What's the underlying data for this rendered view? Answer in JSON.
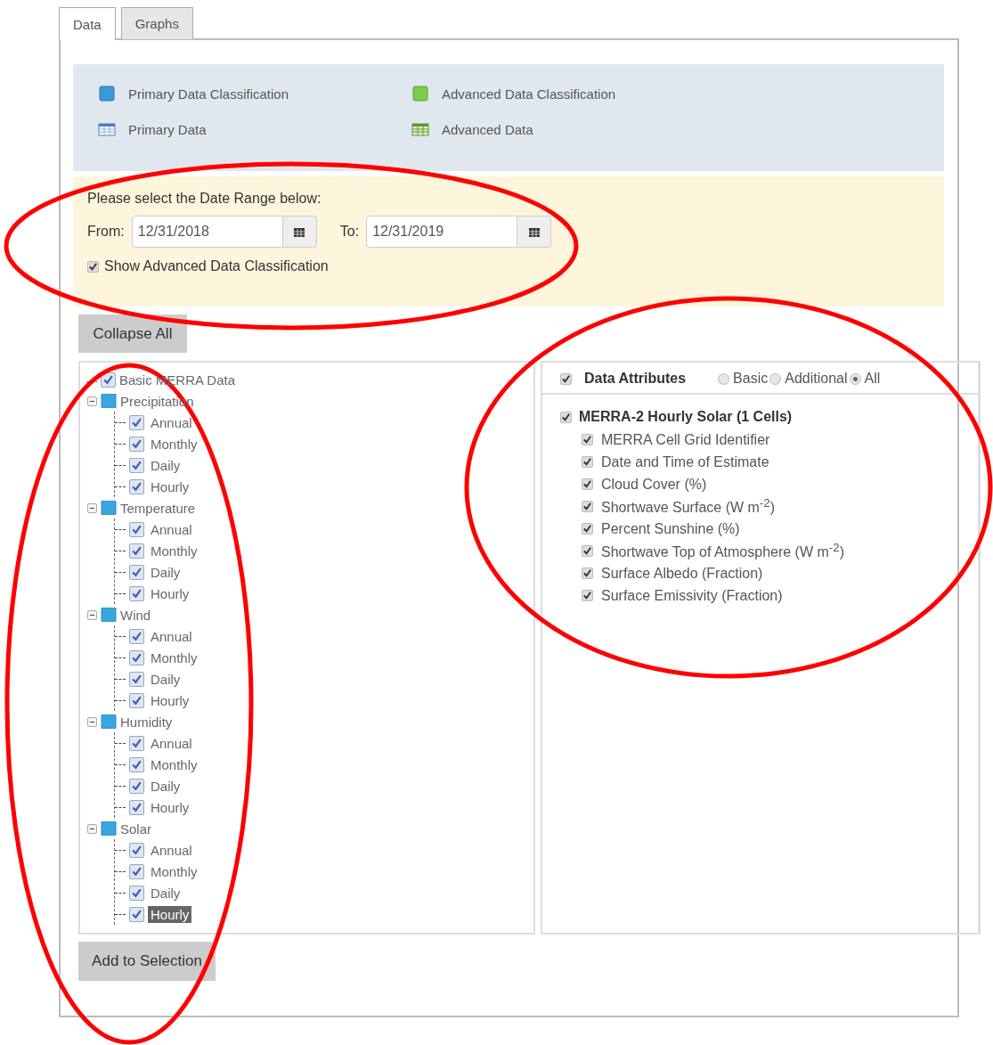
{
  "tabs": [
    {
      "label": "Data",
      "selected": true
    },
    {
      "label": "Graphs",
      "selected": false
    }
  ],
  "legend": [
    {
      "label": "Primary Data Classification",
      "kind": "primary-class"
    },
    {
      "label": "Advanced Data Classification",
      "kind": "advanced-class"
    },
    {
      "label": "Primary Data",
      "kind": "primary-data"
    },
    {
      "label": "Advanced Data",
      "kind": "advanced-data"
    }
  ],
  "date_range": {
    "circled": true,
    "prompt": "Please select the Date Range below:",
    "from_label": "From:",
    "from_value": "12/31/2018",
    "to_label": "To:",
    "to_value": "12/31/2019",
    "advanced_option": {
      "label": "Show Advanced Data Classification",
      "checked": true
    }
  },
  "collapse_button": "Collapse All",
  "tree": {
    "circled": true,
    "root": {
      "label": "Basic MERRA Data",
      "checked": true,
      "children": [
        {
          "label": "Precipitation",
          "expanded": true,
          "children": [
            {
              "label": "Annual",
              "checked": true,
              "selected": false
            },
            {
              "label": "Monthly",
              "checked": true,
              "selected": false
            },
            {
              "label": "Daily",
              "checked": true,
              "selected": false
            },
            {
              "label": "Hourly",
              "checked": true,
              "selected": false
            }
          ]
        },
        {
          "label": "Temperature",
          "expanded": true,
          "children": [
            {
              "label": "Annual",
              "checked": true,
              "selected": false
            },
            {
              "label": "Monthly",
              "checked": true,
              "selected": false
            },
            {
              "label": "Daily",
              "checked": true,
              "selected": false
            },
            {
              "label": "Hourly",
              "checked": true,
              "selected": false
            }
          ]
        },
        {
          "label": "Wind",
          "expanded": true,
          "children": [
            {
              "label": "Annual",
              "checked": true,
              "selected": false
            },
            {
              "label": "Monthly",
              "checked": true,
              "selected": false
            },
            {
              "label": "Daily",
              "checked": true,
              "selected": false
            },
            {
              "label": "Hourly",
              "checked": true,
              "selected": false
            }
          ]
        },
        {
          "label": "Humidity",
          "expanded": true,
          "children": [
            {
              "label": "Annual",
              "checked": true,
              "selected": false
            },
            {
              "label": "Monthly",
              "checked": true,
              "selected": false
            },
            {
              "label": "Daily",
              "checked": true,
              "selected": false
            },
            {
              "label": "Hourly",
              "checked": true,
              "selected": false
            }
          ]
        },
        {
          "label": "Solar",
          "expanded": true,
          "children": [
            {
              "label": "Annual",
              "checked": true,
              "selected": false
            },
            {
              "label": "Monthly",
              "checked": true,
              "selected": false
            },
            {
              "label": "Daily",
              "checked": true,
              "selected": false
            },
            {
              "label": "Hourly",
              "checked": true,
              "selected": true
            }
          ]
        }
      ]
    }
  },
  "attributes": {
    "circled": true,
    "header": {
      "label": "Data Attributes",
      "checked": true
    },
    "options": [
      {
        "label": "Basic",
        "selected": false
      },
      {
        "label": "Additional",
        "selected": false
      },
      {
        "label": "All",
        "selected": true
      }
    ],
    "group": {
      "label": "MERRA-2 Hourly Solar (1 Cells)",
      "checked": true,
      "items": [
        {
          "label": "MERRA Cell Grid Identifier",
          "checked": true
        },
        {
          "label": "Date and Time of Estimate",
          "checked": true
        },
        {
          "label": "Cloud Cover (%)",
          "checked": true
        },
        {
          "label": "Shortwave Surface (W m$^{-2}$)",
          "checked": true
        },
        {
          "label": "Percent Sunshine (%)",
          "checked": true
        },
        {
          "label": "Shortwave Top of Atmosphere (W m$^{-2}$)",
          "checked": true
        },
        {
          "label": "Surface Albedo (Fraction)",
          "checked": true
        },
        {
          "label": "Surface Emissivity (Fraction)",
          "checked": true
        }
      ]
    }
  },
  "add_button": "Add to Selection"
}
